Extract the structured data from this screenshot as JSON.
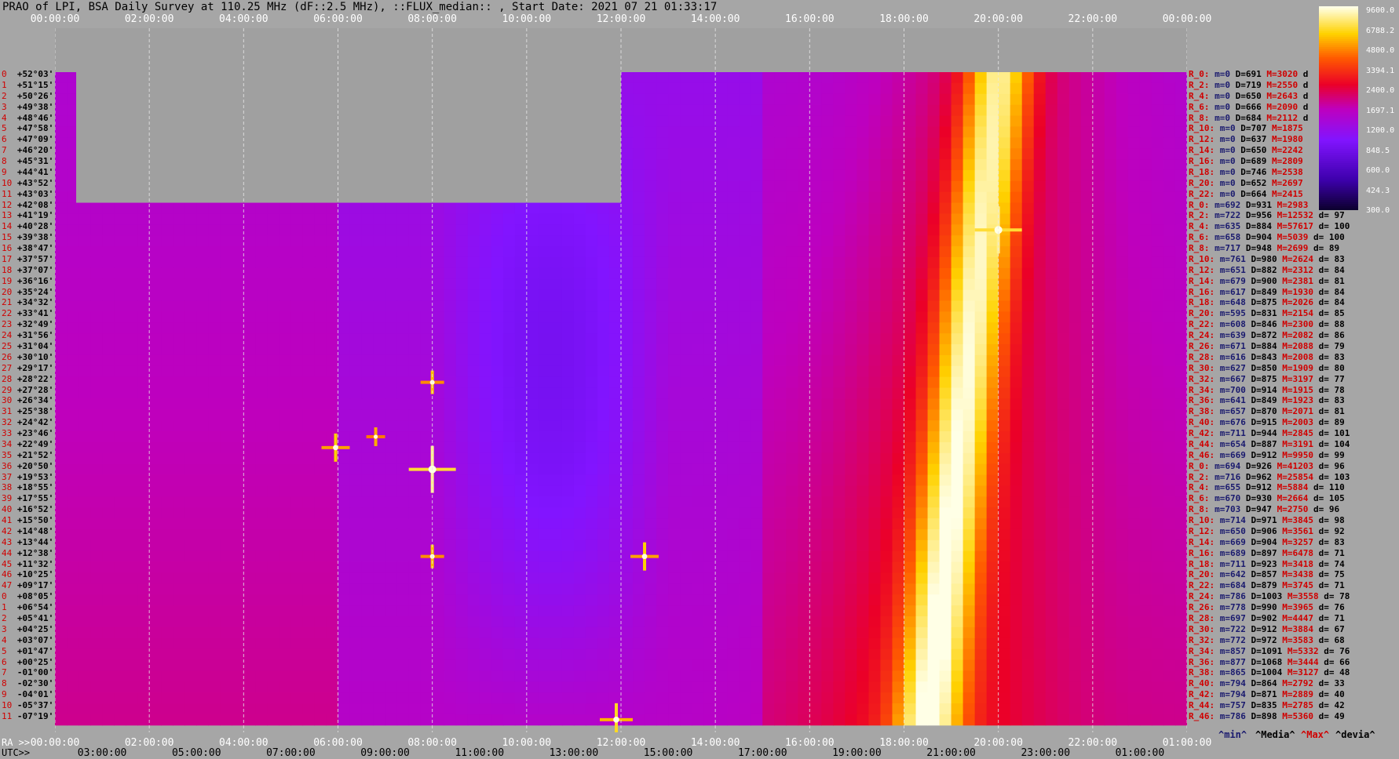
{
  "title": "PRAO of LPI, BSA Daily Survey at 110.25 MHz (dF::2.5 MHz), ::FLUX_median:: , Start Date: 2021 07 21 01:33:17",
  "colors": {
    "background": "#a6a6a6",
    "masked": "#a0a0a0",
    "grid": "#e8e8e8"
  },
  "top_ticks": [
    "00:00:00",
    "02:00:00",
    "04:00:00",
    "06:00:00",
    "08:00:00",
    "10:00:00",
    "12:00:00",
    "14:00:00",
    "16:00:00",
    "18:00:00",
    "20:00:00",
    "22:00:00",
    "00:00:00"
  ],
  "bottom_ra_label": "RA >>",
  "bottom_ra_ticks": [
    "00:00:00",
    "02:00:00",
    "04:00:00",
    "06:00:00",
    "08:00:00",
    "10:00:00",
    "12:00:00",
    "14:00:00",
    "16:00:00",
    "18:00:00",
    "20:00:00",
    "22:00:00",
    "01:00:00"
  ],
  "bottom_utc_label": "UTC>>",
  "bottom_utc_ticks": [
    "03:00:00",
    "05:00:00",
    "07:00:00",
    "09:00:00",
    "11:00:00",
    "13:00:00",
    "15:00:00",
    "17:00:00",
    "19:00:00",
    "21:00:00",
    "23:00:00",
    "01:00:00"
  ],
  "colorbar_ticks": [
    "9600.0",
    "6788.2",
    "4800.0",
    "3394.1",
    "2400.0",
    "1697.1",
    "1200.0",
    "848.5",
    "600.0",
    "424.3",
    "300.0"
  ],
  "legend": {
    "min": "^min^",
    "median": "^Media^",
    "max": "^Max^",
    "devia": "^devia^"
  },
  "chart_data": {
    "type": "heatmap",
    "title": "PRAO of LPI, BSA Daily Survey at 110.25 MHz (dF::2.5 MHz), ::FLUX_median:: , Start Date: 2021 07 21 01:33:17",
    "x_axis": "RA (hours)",
    "xlim": [
      0,
      24
    ],
    "color_scale": {
      "min": 300.0,
      "max": 9600.0,
      "scale": "log"
    },
    "rows": [
      {
        "idx": "0",
        "dec": "+52°03'",
        "r": "R_0:",
        "m": "m=0",
        "d": "D=691",
        "mx": "M=3020",
        "dv": "d"
      },
      {
        "idx": "1",
        "dec": "+51°15'",
        "r": "R_2:",
        "m": "m=0",
        "d": "D=719",
        "mx": "M=2550",
        "dv": "d"
      },
      {
        "idx": "2",
        "dec": "+50°26'",
        "r": "R_4:",
        "m": "m=0",
        "d": "D=650",
        "mx": "M=2643",
        "dv": "d"
      },
      {
        "idx": "3",
        "dec": "+49°38'",
        "r": "R_6:",
        "m": "m=0",
        "d": "D=666",
        "mx": "M=2090",
        "dv": "d"
      },
      {
        "idx": "4",
        "dec": "+48°46'",
        "r": "R_8:",
        "m": "m=0",
        "d": "D=684",
        "mx": "M=2112",
        "dv": "d"
      },
      {
        "idx": "5",
        "dec": "+47°58'",
        "r": "R_10:",
        "m": "m=0",
        "d": "D=707",
        "mx": "M=1875",
        "dv": ""
      },
      {
        "idx": "6",
        "dec": "+47°09'",
        "r": "R_12:",
        "m": "m=0",
        "d": "D=637",
        "mx": "M=1980",
        "dv": ""
      },
      {
        "idx": "7",
        "dec": "+46°20'",
        "r": "R_14:",
        "m": "m=0",
        "d": "D=650",
        "mx": "M=2242",
        "dv": ""
      },
      {
        "idx": "8",
        "dec": "+45°31'",
        "r": "R_16:",
        "m": "m=0",
        "d": "D=689",
        "mx": "M=2809",
        "dv": ""
      },
      {
        "idx": "9",
        "dec": "+44°41'",
        "r": "R_18:",
        "m": "m=0",
        "d": "D=746",
        "mx": "M=2538",
        "dv": ""
      },
      {
        "idx": "10",
        "dec": "+43°52'",
        "r": "R_20:",
        "m": "m=0",
        "d": "D=652",
        "mx": "M=2697",
        "dv": ""
      },
      {
        "idx": "11",
        "dec": "+43°03'",
        "r": "R_22:",
        "m": "m=0",
        "d": "D=664",
        "mx": "M=2415",
        "dv": ""
      },
      {
        "idx": "12",
        "dec": "+42°08'",
        "r": "R_0:",
        "m": "m=692",
        "d": "D=931",
        "mx": "M=2983",
        "dv": ""
      },
      {
        "idx": "13",
        "dec": "+41°19'",
        "r": "R_2:",
        "m": "m=722",
        "d": "D=956",
        "mx": "M=12532",
        "dv": "d= 97"
      },
      {
        "idx": "14",
        "dec": "+40°28'",
        "r": "R_4:",
        "m": "m=635",
        "d": "D=884",
        "mx": "M=57617",
        "dv": "d= 100"
      },
      {
        "idx": "15",
        "dec": "+39°38'",
        "r": "R_6:",
        "m": "m=658",
        "d": "D=904",
        "mx": "M=5039",
        "dv": "d= 100"
      },
      {
        "idx": "16",
        "dec": "+38°47'",
        "r": "R_8:",
        "m": "m=717",
        "d": "D=948",
        "mx": "M=2699",
        "dv": "d= 89"
      },
      {
        "idx": "17",
        "dec": "+37°57'",
        "r": "R_10:",
        "m": "m=761",
        "d": "D=980",
        "mx": "M=2624",
        "dv": "d= 83"
      },
      {
        "idx": "18",
        "dec": "+37°07'",
        "r": "R_12:",
        "m": "m=651",
        "d": "D=882",
        "mx": "M=2312",
        "dv": "d= 84"
      },
      {
        "idx": "19",
        "dec": "+36°16'",
        "r": "R_14:",
        "m": "m=679",
        "d": "D=900",
        "mx": "M=2381",
        "dv": "d= 81"
      },
      {
        "idx": "20",
        "dec": "+35°24'",
        "r": "R_16:",
        "m": "m=617",
        "d": "D=849",
        "mx": "M=1930",
        "dv": "d= 84"
      },
      {
        "idx": "21",
        "dec": "+34°32'",
        "r": "R_18:",
        "m": "m=648",
        "d": "D=875",
        "mx": "M=2026",
        "dv": "d= 84"
      },
      {
        "idx": "22",
        "dec": "+33°41'",
        "r": "R_20:",
        "m": "m=595",
        "d": "D=831",
        "mx": "M=2154",
        "dv": "d= 85"
      },
      {
        "idx": "23",
        "dec": "+32°49'",
        "r": "R_22:",
        "m": "m=608",
        "d": "D=846",
        "mx": "M=2300",
        "dv": "d= 88"
      },
      {
        "idx": "24",
        "dec": "+31°56'",
        "r": "R_24:",
        "m": "m=639",
        "d": "D=872",
        "mx": "M=2082",
        "dv": "d= 86"
      },
      {
        "idx": "25",
        "dec": "+31°04'",
        "r": "R_26:",
        "m": "m=671",
        "d": "D=884",
        "mx": "M=2088",
        "dv": "d= 79"
      },
      {
        "idx": "26",
        "dec": "+30°10'",
        "r": "R_28:",
        "m": "m=616",
        "d": "D=843",
        "mx": "M=2008",
        "dv": "d= 83"
      },
      {
        "idx": "27",
        "dec": "+29°17'",
        "r": "R_30:",
        "m": "m=627",
        "d": "D=850",
        "mx": "M=1909",
        "dv": "d= 80"
      },
      {
        "idx": "28",
        "dec": "+28°22'",
        "r": "R_32:",
        "m": "m=667",
        "d": "D=875",
        "mx": "M=3197",
        "dv": "d= 77"
      },
      {
        "idx": "29",
        "dec": "+27°28'",
        "r": "R_34:",
        "m": "m=700",
        "d": "D=914",
        "mx": "M=1915",
        "dv": "d= 78"
      },
      {
        "idx": "30",
        "dec": "+26°34'",
        "r": "R_36:",
        "m": "m=641",
        "d": "D=849",
        "mx": "M=1923",
        "dv": "d= 83"
      },
      {
        "idx": "31",
        "dec": "+25°38'",
        "r": "R_38:",
        "m": "m=657",
        "d": "D=870",
        "mx": "M=2071",
        "dv": "d= 81"
      },
      {
        "idx": "32",
        "dec": "+24°42'",
        "r": "R_40:",
        "m": "m=676",
        "d": "D=915",
        "mx": "M=2003",
        "dv": "d= 89"
      },
      {
        "idx": "33",
        "dec": "+23°46'",
        "r": "R_42:",
        "m": "m=711",
        "d": "D=944",
        "mx": "M=2845",
        "dv": "d= 101"
      },
      {
        "idx": "34",
        "dec": "+22°49'",
        "r": "R_44:",
        "m": "m=654",
        "d": "D=887",
        "mx": "M=3191",
        "dv": "d= 104"
      },
      {
        "idx": "35",
        "dec": "+21°52'",
        "r": "R_46:",
        "m": "m=669",
        "d": "D=912",
        "mx": "M=9950",
        "dv": "d= 99"
      },
      {
        "idx": "36",
        "dec": "+20°50'",
        "r": "R_0:",
        "m": "m=694",
        "d": "D=926",
        "mx": "M=41203",
        "dv": "d= 96"
      },
      {
        "idx": "37",
        "dec": "+19°53'",
        "r": "R_2:",
        "m": "m=716",
        "d": "D=962",
        "mx": "M=25854",
        "dv": "d= 103"
      },
      {
        "idx": "38",
        "dec": "+18°55'",
        "r": "R_4:",
        "m": "m=655",
        "d": "D=912",
        "mx": "M=5884",
        "dv": "d= 110"
      },
      {
        "idx": "39",
        "dec": "+17°55'",
        "r": "R_6:",
        "m": "m=670",
        "d": "D=930",
        "mx": "M=2664",
        "dv": "d= 105"
      },
      {
        "idx": "40",
        "dec": "+16°52'",
        "r": "R_8:",
        "m": "m=703",
        "d": "D=947",
        "mx": "M=2750",
        "dv": "d= 96"
      },
      {
        "idx": "41",
        "dec": "+15°50'",
        "r": "R_10:",
        "m": "m=714",
        "d": "D=971",
        "mx": "M=3845",
        "dv": "d= 98"
      },
      {
        "idx": "42",
        "dec": "+14°48'",
        "r": "R_12:",
        "m": "m=650",
        "d": "D=906",
        "mx": "M=3561",
        "dv": "d= 92"
      },
      {
        "idx": "43",
        "dec": "+13°44'",
        "r": "R_14:",
        "m": "m=669",
        "d": "D=904",
        "mx": "M=3257",
        "dv": "d= 83"
      },
      {
        "idx": "44",
        "dec": "+12°38'",
        "r": "R_16:",
        "m": "m=689",
        "d": "D=897",
        "mx": "M=6478",
        "dv": "d= 71"
      },
      {
        "idx": "45",
        "dec": "+11°32'",
        "r": "R_18:",
        "m": "m=711",
        "d": "D=923",
        "mx": "M=3418",
        "dv": "d= 74"
      },
      {
        "idx": "46",
        "dec": "+10°25'",
        "r": "R_20:",
        "m": "m=642",
        "d": "D=857",
        "mx": "M=3438",
        "dv": "d= 75"
      },
      {
        "idx": "47",
        "dec": "+09°17'",
        "r": "R_22:",
        "m": "m=684",
        "d": "D=879",
        "mx": "M=3745",
        "dv": "d= 71"
      },
      {
        "idx": "0",
        "dec": "+08°05'",
        "r": "R_24:",
        "m": "m=786",
        "d": "D=1003",
        "mx": "M=3558",
        "dv": "d= 78"
      },
      {
        "idx": "1",
        "dec": "+06°54'",
        "r": "R_26:",
        "m": "m=778",
        "d": "D=990",
        "mx": "M=3965",
        "dv": "d= 76"
      },
      {
        "idx": "2",
        "dec": "+05°41'",
        "r": "R_28:",
        "m": "m=697",
        "d": "D=902",
        "mx": "M=4447",
        "dv": "d= 71"
      },
      {
        "idx": "3",
        "dec": "+04°25'",
        "r": "R_30:",
        "m": "m=722",
        "d": "D=912",
        "mx": "M=3884",
        "dv": "d= 67"
      },
      {
        "idx": "4",
        "dec": "+03°07'",
        "r": "R_32:",
        "m": "m=772",
        "d": "D=972",
        "mx": "M=3583",
        "dv": "d= 68"
      },
      {
        "idx": "5",
        "dec": "+01°47'",
        "r": "R_34:",
        "m": "m=857",
        "d": "D=1091",
        "mx": "M=5332",
        "dv": "d= 76"
      },
      {
        "idx": "6",
        "dec": "+00°25'",
        "r": "R_36:",
        "m": "m=877",
        "d": "D=1068",
        "mx": "M=3444",
        "dv": "d= 66"
      },
      {
        "idx": "7",
        "dec": "-01°00'",
        "r": "R_38:",
        "m": "m=865",
        "d": "D=1004",
        "mx": "M=3127",
        "dv": "d= 48"
      },
      {
        "idx": "8",
        "dec": "-02°30'",
        "r": "R_40:",
        "m": "m=794",
        "d": "D=864",
        "mx": "M=2792",
        "dv": "d= 33"
      },
      {
        "idx": "9",
        "dec": "-04°01'",
        "r": "R_42:",
        "m": "m=794",
        "d": "D=871",
        "mx": "M=2889",
        "dv": "d= 40"
      },
      {
        "idx": "10",
        "dec": "-05°37'",
        "r": "R_44:",
        "m": "m=757",
        "d": "D=835",
        "mx": "M=2785",
        "dv": "d= 42"
      },
      {
        "idx": "11",
        "dec": "-07°19'",
        "r": "R_46:",
        "m": "m=786",
        "d": "D=898",
        "mx": "M=5360",
        "dv": "d= 49"
      }
    ],
    "masked_region": {
      "ra_from": 0.45,
      "ra_to": 12.0,
      "rows_from": 0,
      "rows_to": 11
    },
    "galactic_plane_band": {
      "ra_start_top": 20.0,
      "ra_end_bottom": 18.5
    },
    "point_sources": [
      {
        "ra": 8.0,
        "row": 36,
        "strength": 1.0
      },
      {
        "ra": 20.0,
        "row": 14,
        "strength": 1.0
      },
      {
        "ra": 5.95,
        "row": 34,
        "strength": 0.6
      },
      {
        "ra": 12.5,
        "row": 44,
        "strength": 0.6
      },
      {
        "ra": 11.9,
        "row": 59,
        "strength": 0.7
      },
      {
        "ra": 8.0,
        "row": 28,
        "strength": 0.5
      },
      {
        "ra": 8.0,
        "row": 44,
        "strength": 0.5
      },
      {
        "ra": 6.8,
        "row": 33,
        "strength": 0.4
      }
    ]
  }
}
